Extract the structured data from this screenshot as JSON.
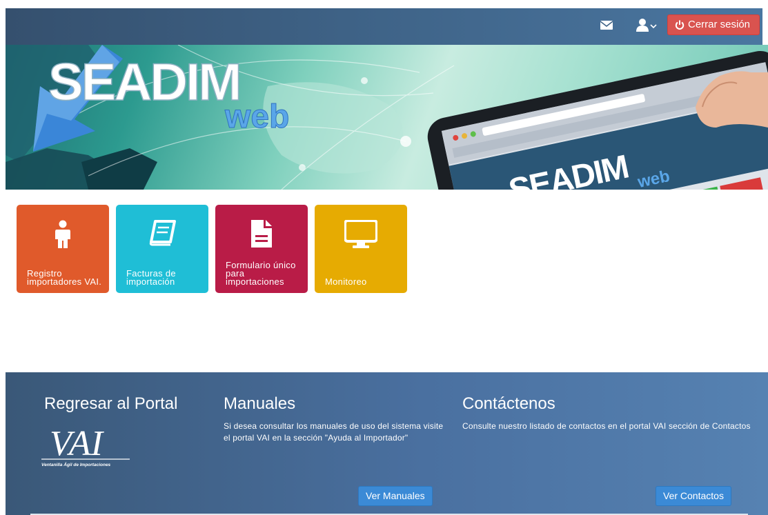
{
  "navbar": {
    "mail_icon": "envelope-icon",
    "user_icon": "user-icon",
    "user_caret_icon": "chevron-down-icon",
    "logout_icon": "power-icon",
    "logout_label": "Cerrar sesión",
    "logout_color": "#d9534f"
  },
  "banner": {
    "title": "SEADIM",
    "subtitle": "web",
    "tablet_title": "SEADIM",
    "tablet_subtitle": "web"
  },
  "tiles": [
    {
      "label": "Registro importadores VAI.",
      "icon": "person-icon",
      "color": "#e05a2b"
    },
    {
      "label": "Facturas de importación",
      "icon": "book-icon",
      "color": "#1fbed6"
    },
    {
      "label": "Formulario único para importaciones",
      "icon": "document-icon",
      "color": "#b91c47"
    },
    {
      "label": "Monitoreo",
      "icon": "monitor-icon",
      "color": "#e6ab02"
    }
  ],
  "footer": {
    "portal": {
      "heading": "Regresar al Portal",
      "logo_text": "VAI",
      "logo_caption": "Ventanilla Ágil de Importaciones"
    },
    "manuales": {
      "heading": "Manuales",
      "text": "Si desea consultar los manuales de uso del sistema visite el portal VAI en la sección \"Ayuda al Importador\"",
      "button": "Ver Manuales"
    },
    "contactos": {
      "heading": "Contáctenos",
      "text": "Consulte nuestro listado de contactos en el portal VAI sección de Contactos",
      "button": "Ver Contactos"
    }
  }
}
